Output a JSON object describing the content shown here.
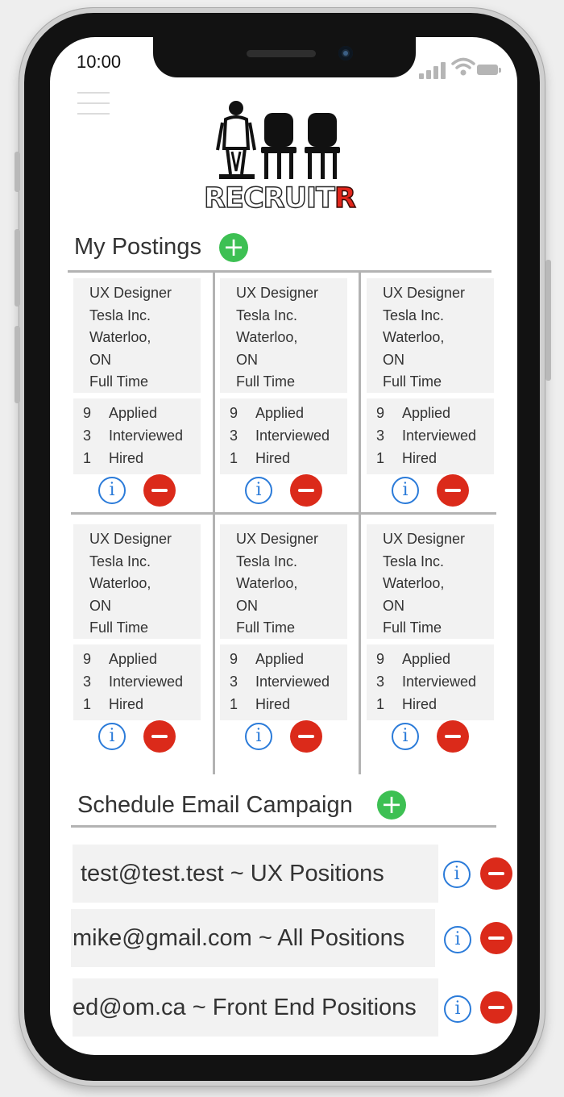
{
  "status_bar": {
    "time": "10:00"
  },
  "logo": {
    "text_main": "RECRUIT",
    "text_accent": "R"
  },
  "postings": {
    "title": "My Postings",
    "cards": [
      {
        "title": "UX Designer",
        "company": "Tesla Inc.",
        "city": "Waterloo,",
        "province": "ON",
        "type": "Full Time",
        "stats": [
          {
            "count": "9",
            "label": "Applied"
          },
          {
            "count": "3",
            "label": "Interviewed"
          },
          {
            "count": "1",
            "label": "Hired"
          }
        ]
      },
      {
        "title": "UX Designer",
        "company": "Tesla Inc.",
        "city": "Waterloo,",
        "province": "ON",
        "type": "Full Time",
        "stats": [
          {
            "count": "9",
            "label": "Applied"
          },
          {
            "count": "3",
            "label": "Interviewed"
          },
          {
            "count": "1",
            "label": "Hired"
          }
        ]
      },
      {
        "title": "UX Designer",
        "company": "Tesla Inc.",
        "city": "Waterloo,",
        "province": "ON",
        "type": "Full Time",
        "stats": [
          {
            "count": "9",
            "label": "Applied"
          },
          {
            "count": "3",
            "label": "Interviewed"
          },
          {
            "count": "1",
            "label": "Hired"
          }
        ]
      },
      {
        "title": "UX Designer",
        "company": "Tesla Inc.",
        "city": "Waterloo,",
        "province": "ON",
        "type": "Full Time",
        "stats": [
          {
            "count": "9",
            "label": "Applied"
          },
          {
            "count": "3",
            "label": "Interviewed"
          },
          {
            "count": "1",
            "label": "Hired"
          }
        ]
      },
      {
        "title": "UX Designer",
        "company": "Tesla Inc.",
        "city": "Waterloo,",
        "province": "ON",
        "type": "Full Time",
        "stats": [
          {
            "count": "9",
            "label": "Applied"
          },
          {
            "count": "3",
            "label": "Interviewed"
          },
          {
            "count": "1",
            "label": "Hired"
          }
        ]
      },
      {
        "title": "UX Designer",
        "company": "Tesla Inc.",
        "city": "Waterloo,",
        "province": "ON",
        "type": "Full Time",
        "stats": [
          {
            "count": "9",
            "label": "Applied"
          },
          {
            "count": "3",
            "label": "Interviewed"
          },
          {
            "count": "1",
            "label": "Hired"
          }
        ]
      }
    ]
  },
  "campaigns": {
    "title": "Schedule Email Campaign",
    "items": [
      {
        "label": "test@test.test ~ UX Positions"
      },
      {
        "label": "mike@gmail.com ~ All Positions"
      },
      {
        "label": "ed@om.ca ~ Front End Positions"
      }
    ]
  },
  "icons": {
    "add": "plus-icon",
    "info": "info-icon",
    "remove": "minus-icon",
    "menu": "hamburger-icon"
  },
  "colors": {
    "add": "#3dc053",
    "info": "#2b7bd9",
    "remove": "#db2a1a",
    "logo_accent": "#e2261c"
  }
}
